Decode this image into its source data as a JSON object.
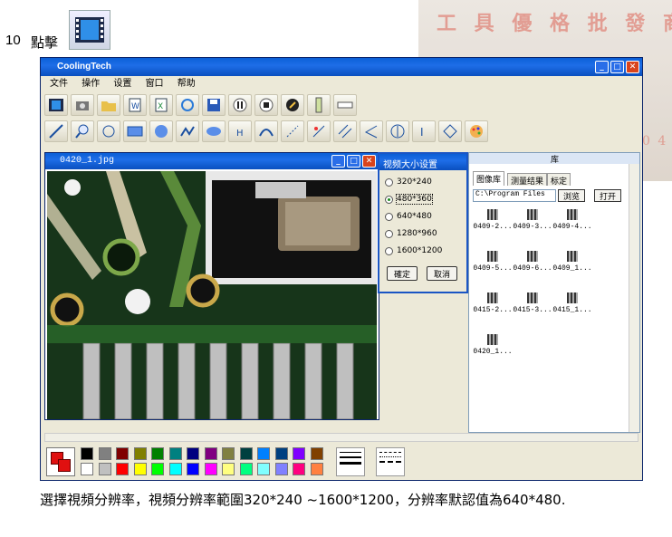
{
  "watermark": {
    "line1": "工 具 優 格 批 發 商 城",
    "line2": "0 2 - 8 7 1 7 3 9 0 4 4 4 4"
  },
  "step": {
    "number": "10",
    "label": "點擊",
    "icon": "video-icon"
  },
  "app": {
    "title": "CoolingTech",
    "menu": [
      "文件",
      "操作",
      "设置",
      "窗口",
      "帮助"
    ],
    "image_window": {
      "title": "0420_1.jpg"
    },
    "dialog": {
      "title": "视频大小设置",
      "options": [
        "320*240",
        "480*360",
        "640*480",
        "1280*960",
        "1600*1200"
      ],
      "selected": "480*360",
      "ok": "確定",
      "cancel": "取消"
    },
    "right_panel": {
      "header": "库",
      "tabs": [
        "图像库",
        "测量结果",
        "标定"
      ],
      "path": "C:\\Program Files",
      "browse": "浏览",
      "open": "打开",
      "thumbnails": [
        "0409-2...",
        "0409-3...",
        "0409-4...",
        "0409-5...",
        "0409-6...",
        "0409_1...",
        "0415-2...",
        "0415-3...",
        "0415_1...",
        "0420_1..."
      ]
    },
    "palette_colors": [
      "#000000",
      "#808080",
      "#800000",
      "#808000",
      "#008000",
      "#008080",
      "#000080",
      "#800080",
      "#808040",
      "#004040",
      "#0080ff",
      "#004080",
      "#8000ff",
      "#804000",
      "#ffffff",
      "#c0c0c0",
      "#ff0000",
      "#ffff00",
      "#00ff00",
      "#00ffff",
      "#0000ff",
      "#ff00ff",
      "#ffff80",
      "#00ff80",
      "#80ffff",
      "#8080ff",
      "#ff0080",
      "#ff8040"
    ]
  },
  "caption": "選擇視頻分辨率，視頻分辨率範圍320*240 ~1600*1200，分辨率默認值為640*480."
}
